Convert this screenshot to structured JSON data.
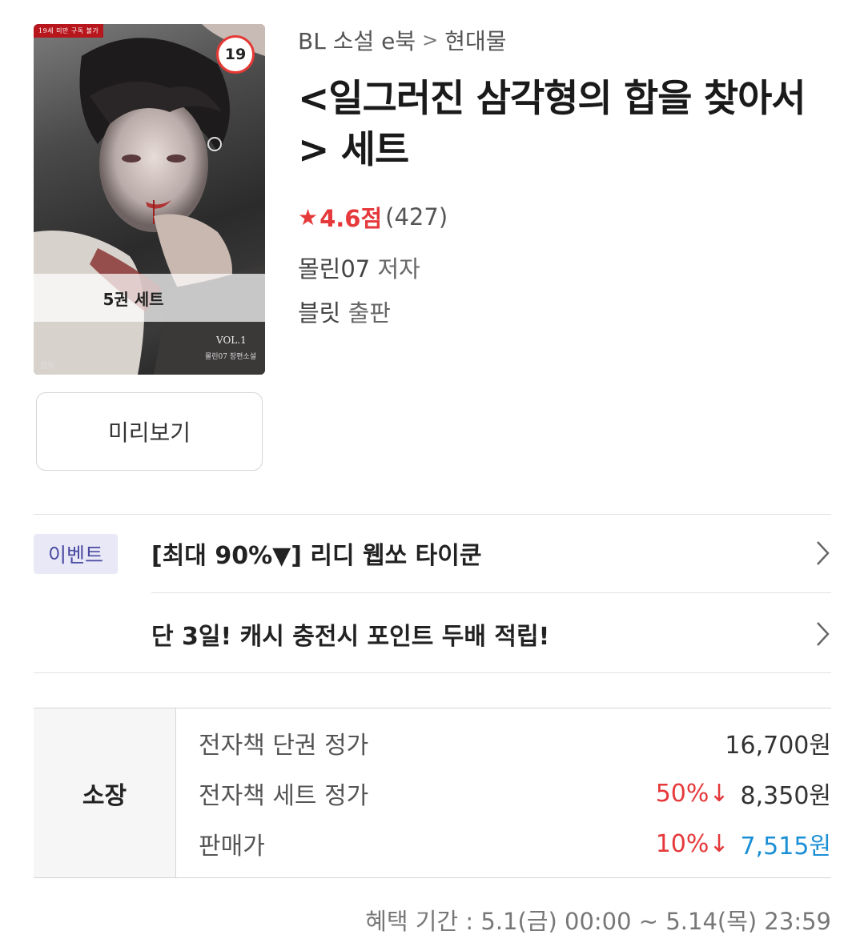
{
  "cover": {
    "age_banner": "19세 미만 구독 불가",
    "age_badge": "19",
    "set_label": "5권 세트",
    "vol": "VOL.1",
    "author_small": "몰린07 장편소설",
    "publisher_mark": "블릿"
  },
  "preview_label": "미리보기",
  "breadcrumb": {
    "category": "BL 소설 e북",
    "separator": ">",
    "subcategory": "현대물"
  },
  "title": "<일그러진 삼각형의 합을 찾아서> 세트",
  "rating": {
    "score": "4.6점",
    "count": "(427)"
  },
  "author": {
    "name": "몰린07",
    "role": "저자"
  },
  "publisher": {
    "name": "블릿",
    "role": "출판"
  },
  "event": {
    "tag": "이벤트",
    "items": [
      "[최대 90%▼] 리디 웹쏘 타이쿤",
      "단 3일! 캐시 충전시 포인트 두배 적립!"
    ]
  },
  "price": {
    "header": "소장",
    "rows": [
      {
        "label": "전자책 단권 정가",
        "discount": "",
        "value": "16,700원"
      },
      {
        "label": "전자책 세트 정가",
        "discount": "50%↓",
        "value": "8,350원"
      },
      {
        "label": "판매가",
        "discount": "10%↓",
        "value": "7,515원"
      }
    ]
  },
  "benefit_period": "혜택 기간 : 5.1(금) 00:00 ~ 5.14(목) 23:59",
  "colors": {
    "accent_red": "#e5393b",
    "final_price_blue": "#1b8fd6",
    "event_tag_bg": "#e8e8f6"
  }
}
